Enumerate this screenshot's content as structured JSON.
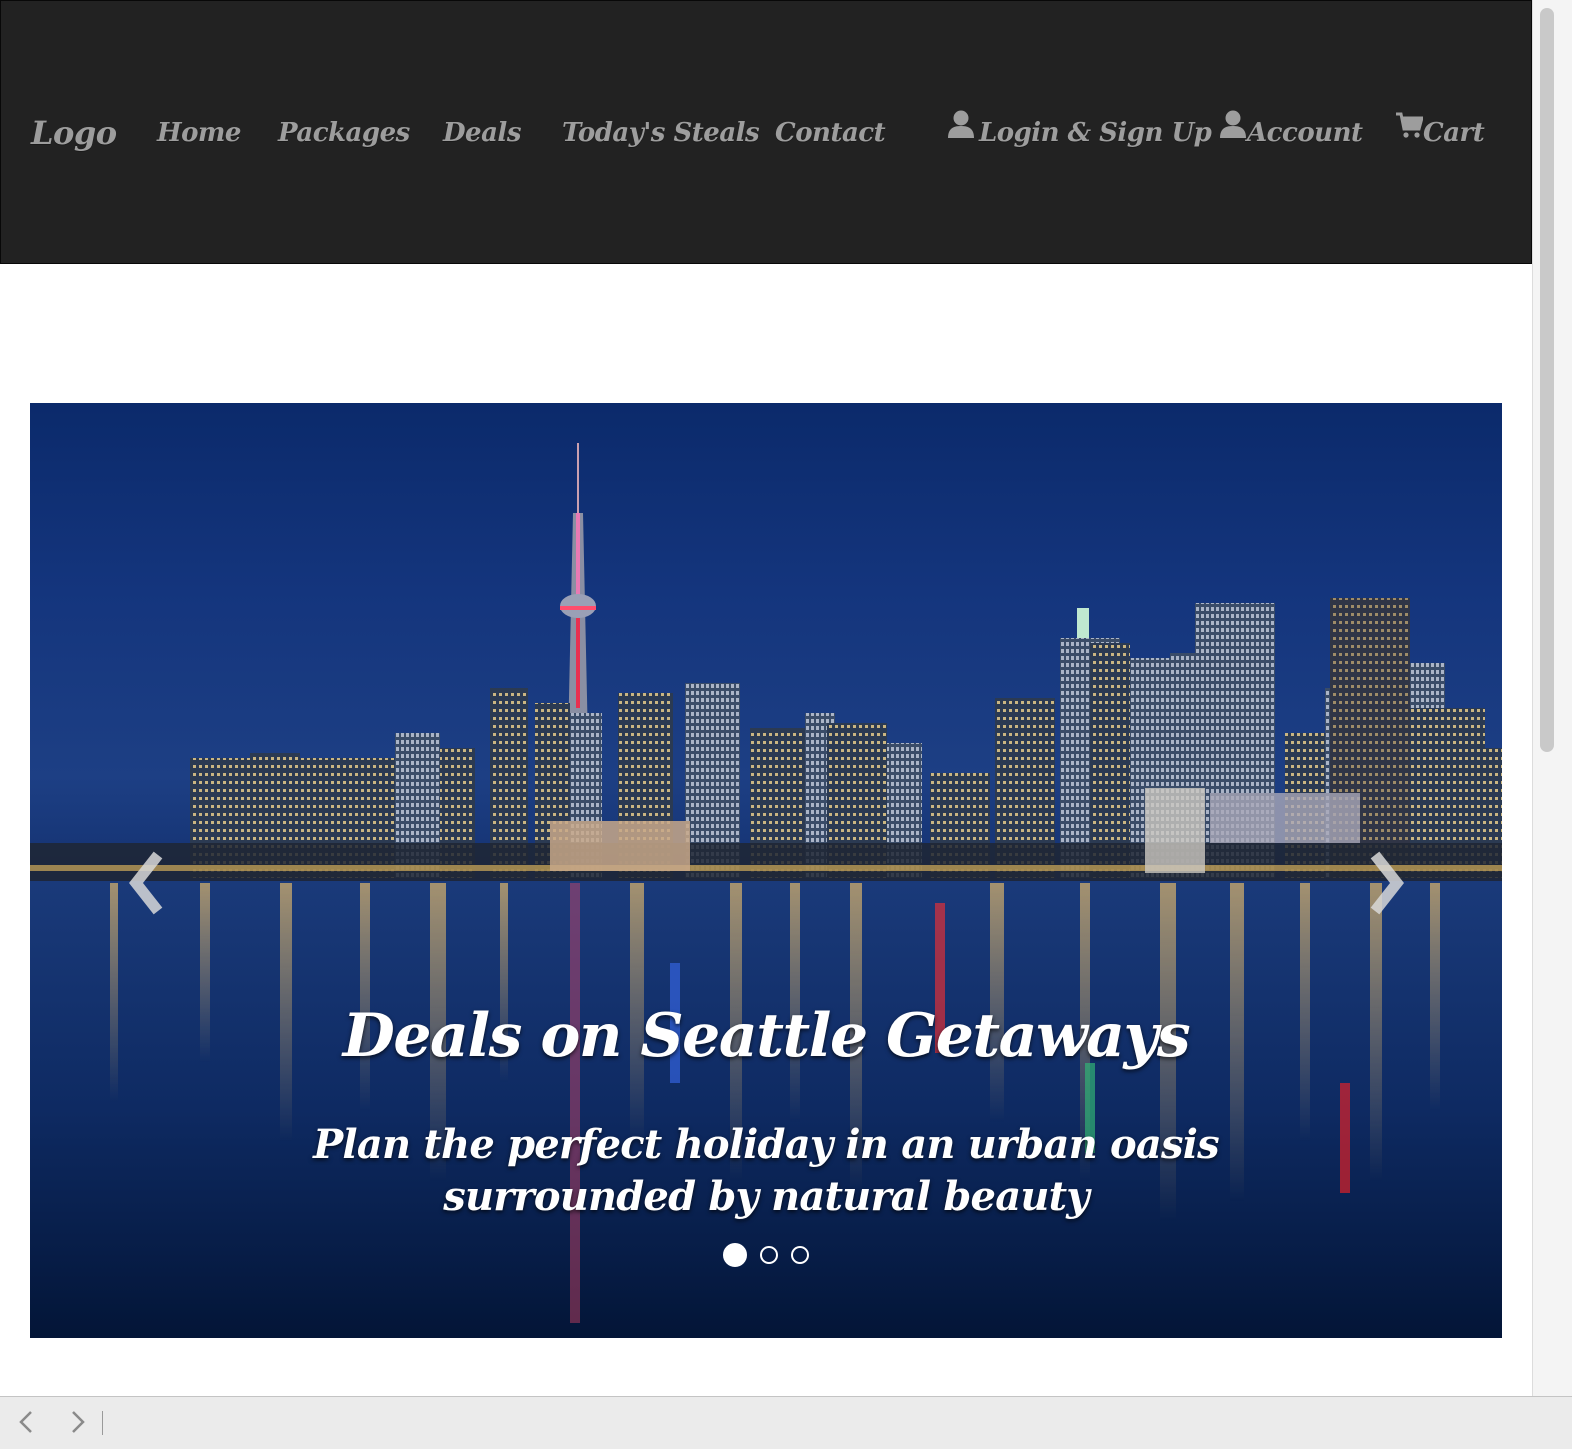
{
  "navbar": {
    "brand": "Logo",
    "links": [
      "Home",
      "Packages",
      "Deals",
      "Today's Steals",
      "Contact"
    ],
    "right": [
      {
        "label": "Login & Sign Up",
        "icon": "user-icon"
      },
      {
        "label": "Account",
        "icon": "user-icon"
      },
      {
        "label": "Cart",
        "icon": "cart-icon"
      }
    ],
    "bg_color": "#222222",
    "text_color": "#9d9d9d"
  },
  "carousel": {
    "title": "Deals on Seattle Getaways",
    "subtitle_line1": "Plan the perfect holiday in an urban oasis",
    "subtitle_line2": "surrounded by natural beauty",
    "slide_count": 3,
    "active_slide": 1,
    "prev_icon": "chevron-left-icon",
    "next_icon": "chevron-right-icon"
  },
  "browser": {
    "back_icon": "chevron-left-icon",
    "forward_icon": "chevron-right-icon"
  }
}
